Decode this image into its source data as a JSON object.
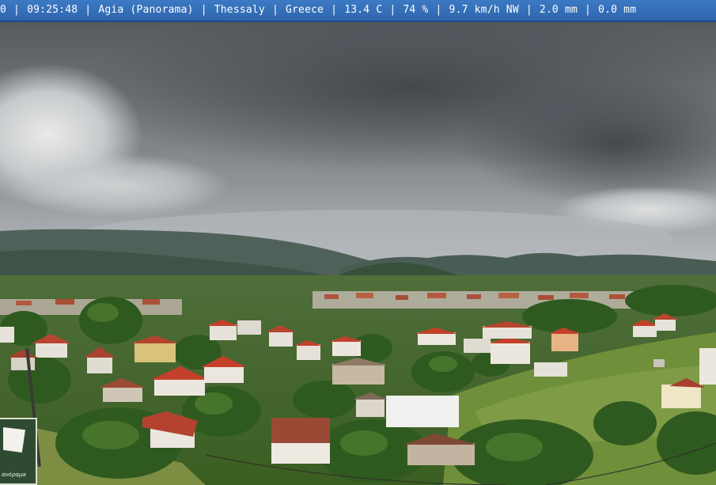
{
  "overlay": {
    "lead": "0",
    "time": "09:25:48",
    "location": "Agia (Panorama)",
    "region": "Thessaly",
    "country": "Greece",
    "temperature": "13.4 C",
    "humidity": "74 %",
    "wind": "9.7 km/h NW",
    "rain_rate": "2.0 mm",
    "rain_total": "0.0 mm"
  },
  "scene": {
    "sky": "overcast-clouds",
    "terrain": "mountains-valley-town",
    "colors": {
      "cloud_light": "#cfd2d4",
      "cloud_dark": "#575c61",
      "mountain": "#3d5048",
      "vegetation": "#3f6b2a",
      "roof": "#b3432e",
      "wall": "#e8e4dc",
      "overlay_bar": "#3470b8"
    }
  },
  "sign": {
    "text": "ανόραμα"
  }
}
